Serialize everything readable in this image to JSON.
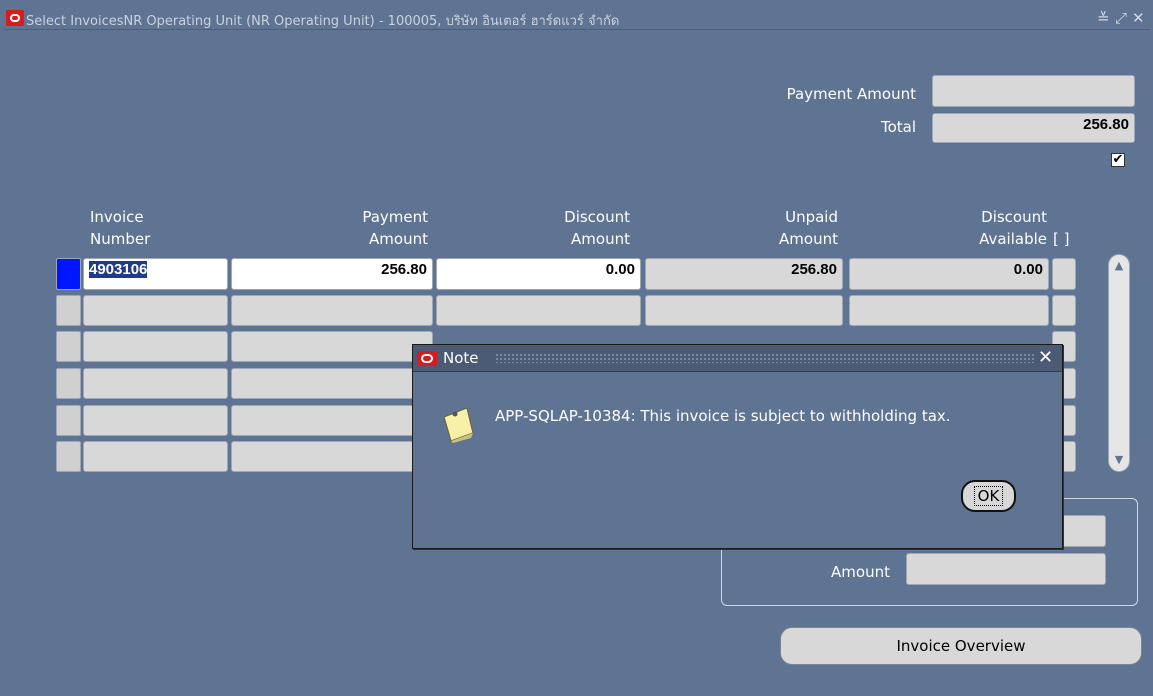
{
  "window": {
    "title": "Select InvoicesNR Operating Unit (NR Operating Unit) - 100005, บริษัท อินเตอร์ ฮาร์ดแวร์ จำกัด",
    "controls": [
      "≚",
      "⤢",
      "✕"
    ]
  },
  "summary": {
    "payment_amount_label": "Payment Amount",
    "payment_amount_value": "",
    "total_label": "Total",
    "total_value": "256.80",
    "checkbox_checked": true,
    "checkbox_mark": "✔"
  },
  "table": {
    "headers": {
      "invoice_number": [
        "Invoice",
        "Number"
      ],
      "payment_amount": [
        "Payment",
        "Amount"
      ],
      "discount_amount": [
        "Discount",
        "Amount"
      ],
      "unpaid_amount": [
        "Unpaid",
        "Amount"
      ],
      "discount_available": [
        "Discount",
        "Available"
      ],
      "flag": "[ ]"
    },
    "rows": [
      {
        "invoice_number": "4903106",
        "payment_amount": "256.80",
        "discount_amount": "0.00",
        "unpaid_amount": "256.80",
        "discount_available": "0.00"
      },
      {
        "invoice_number": "",
        "payment_amount": "",
        "discount_amount": "",
        "unpaid_amount": "",
        "discount_available": ""
      },
      {
        "invoice_number": "",
        "payment_amount": "",
        "discount_amount": "",
        "unpaid_amount": "",
        "discount_available": ""
      },
      {
        "invoice_number": "",
        "payment_amount": "",
        "discount_amount": "",
        "unpaid_amount": "",
        "discount_available": ""
      },
      {
        "invoice_number": "",
        "payment_amount": "",
        "discount_amount": "",
        "unpaid_amount": "",
        "discount_available": ""
      },
      {
        "invoice_number": "",
        "payment_amount": "",
        "discount_amount": "",
        "unpaid_amount": "",
        "discount_available": ""
      }
    ]
  },
  "group": {
    "amount_label": "Amount",
    "amount_value": "",
    "top_value": ""
  },
  "buttons": {
    "invoice_overview": "Invoice Overview"
  },
  "dialog": {
    "title": "Note",
    "message": "APP-SQLAP-10384: This invoice is subject to withholding tax.",
    "ok_label": "OK",
    "close": "✕"
  },
  "colors": {
    "background": "#5f7392",
    "active_row_indicator": "#0016ff",
    "oracle_logo": "#d61c1c"
  }
}
